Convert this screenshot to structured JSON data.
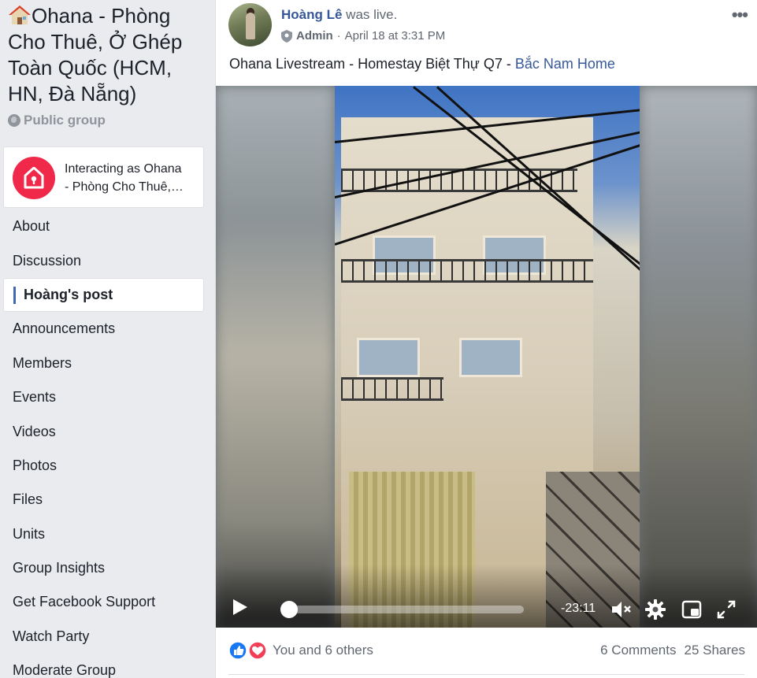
{
  "group": {
    "title": "Ohana - Phòng Cho Thuê, Ở Ghép Toàn Quốc (HCM, HN, Đà Nẵng)",
    "title_icon": "house-emoji",
    "privacy": "Public group"
  },
  "interacting": {
    "line1": "Interacting as Ohana",
    "line2": "- Phòng Cho Thuê,…"
  },
  "nav": [
    {
      "label": "About",
      "active": false
    },
    {
      "label": "Discussion",
      "active": false
    },
    {
      "label": "Hoàng's post",
      "active": true
    },
    {
      "label": "Announcements",
      "active": false
    },
    {
      "label": "Members",
      "active": false
    },
    {
      "label": "Events",
      "active": false
    },
    {
      "label": "Videos",
      "active": false
    },
    {
      "label": "Photos",
      "active": false
    },
    {
      "label": "Files",
      "active": false
    },
    {
      "label": "Units",
      "active": false
    },
    {
      "label": "Group Insights",
      "active": false
    },
    {
      "label": "Get Facebook Support",
      "active": false
    },
    {
      "label": "Watch Party",
      "active": false
    },
    {
      "label": "Moderate Group",
      "active": false
    }
  ],
  "post": {
    "author": "Hoàng Lê",
    "action": " was live.",
    "role": "Admin",
    "separator": " · ",
    "time": "April 18 at 3:31 PM",
    "text_prefix": "Ohana Livestream - Homestay Biệt Thự Q7 - ",
    "text_link": "Bắc Nam Home",
    "more": "•••"
  },
  "video": {
    "time_remaining": "-23:11",
    "progress": 0.0
  },
  "footer": {
    "reactions_text": "You and 6 others",
    "comments": "6 Comments",
    "shares": "25 Shares"
  },
  "colors": {
    "link": "#365899",
    "accent": "#4267b2",
    "brand_red": "#f0284a"
  }
}
